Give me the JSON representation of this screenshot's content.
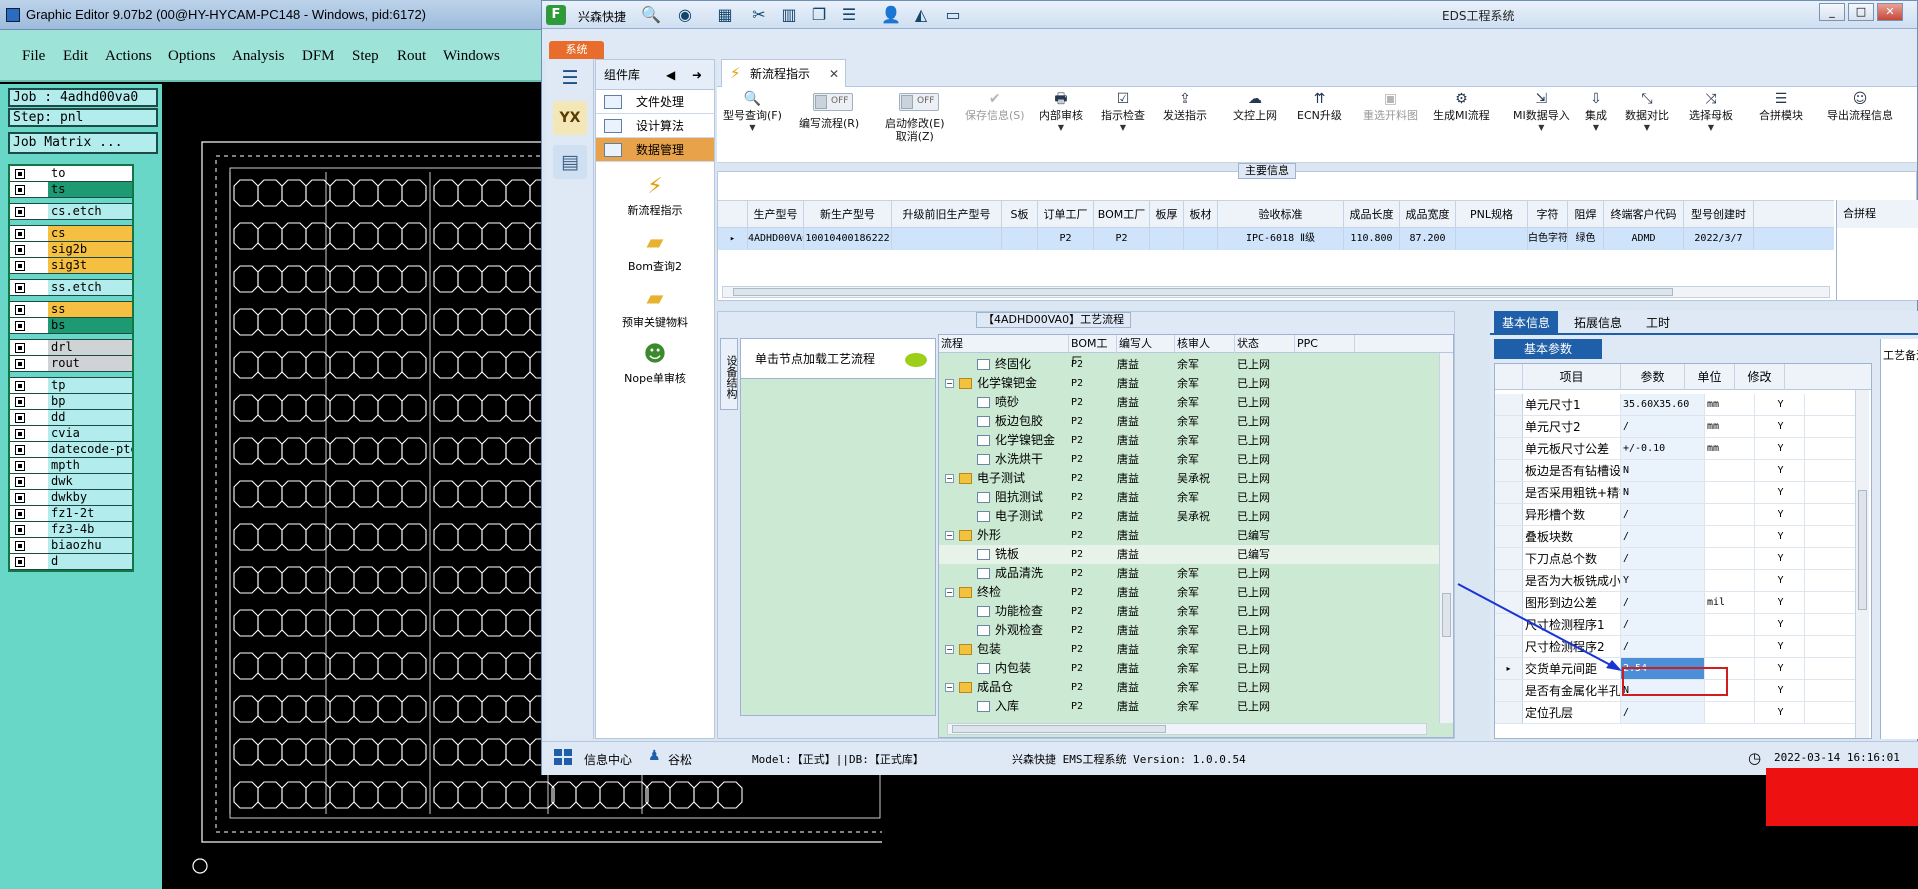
{
  "graphic_editor": {
    "title": "Graphic Editor 9.07b2 (00@HY-HYCAM-PC148 - Windows, pid:6172)",
    "menu": [
      "File",
      "Edit",
      "Actions",
      "Options",
      "Analysis",
      "DFM",
      "Step",
      "Rout",
      "Windows"
    ],
    "job": "Job : 4adhd00va0",
    "step": "Step: pnl",
    "job_matrix": "Job Matrix ...",
    "layers": [
      {
        "name": "to",
        "color": "#ffffff"
      },
      {
        "name": "ts",
        "color": "#1d9a72"
      },
      {
        "name": "cs.etch",
        "color": "#b2ecec"
      },
      {
        "name": "cs",
        "color": "#f5c042"
      },
      {
        "name": "sig2b",
        "color": "#f5c042"
      },
      {
        "name": "sig3t",
        "color": "#f5c042"
      },
      {
        "name": "ss.etch",
        "color": "#b2ecec"
      },
      {
        "name": "ss",
        "color": "#f5c042"
      },
      {
        "name": "bs",
        "color": "#1d9a72"
      },
      {
        "name": "drl",
        "color": "#cfd3d6"
      },
      {
        "name": "rout",
        "color": "#cfd3d6"
      },
      {
        "name": "tp",
        "color": "#b2ecec"
      },
      {
        "name": "bp",
        "color": "#b2ecec"
      },
      {
        "name": "dd",
        "color": "#b2ecec"
      },
      {
        "name": "cvia",
        "color": "#b2ecec"
      },
      {
        "name": "datecode-pte",
        "color": "#b2ecec"
      },
      {
        "name": "mpth",
        "color": "#b2ecec"
      },
      {
        "name": "dwk",
        "color": "#b2ecec"
      },
      {
        "name": "dwkby",
        "color": "#b2ecec"
      },
      {
        "name": "fz1-2t",
        "color": "#b2ecec"
      },
      {
        "name": "fz3-4b",
        "color": "#b2ecec"
      },
      {
        "name": "biaozhu",
        "color": "#b2ecec"
      },
      {
        "name": "d",
        "color": "#b2ecec"
      }
    ]
  },
  "eds": {
    "title": "EDS工程系统",
    "brand": "兴森快捷",
    "system_tab": "系统",
    "component_panel": {
      "title": "组件库",
      "items": [
        "文件处理",
        "设计算法",
        "数据管理"
      ],
      "big_items": [
        "新流程指示",
        "Bom查询2",
        "预审关键物料",
        "Nope单审核"
      ]
    },
    "tab": "新流程指示",
    "toolbar": [
      {
        "label": "型号查询(F)",
        "icon": "🔍",
        "dd": true,
        "disabled": false
      },
      {
        "label": "编写流程(R)",
        "icon": "",
        "dd": false,
        "disabled": false,
        "toggle": "OFF"
      },
      {
        "label": "启动修改(E)\n取消(Z)",
        "icon": "",
        "dd": false,
        "disabled": false,
        "toggle": "OFF"
      },
      {
        "label": "保存信息(S)",
        "icon": "✔",
        "dd": false,
        "disabled": true
      },
      {
        "label": "内部审核",
        "icon": "🖶",
        "dd": true,
        "disabled": false
      },
      {
        "label": "指示检查",
        "icon": "☑",
        "dd": true,
        "disabled": false
      },
      {
        "label": "发送指示",
        "icon": "⇪",
        "dd": false,
        "disabled": false
      },
      {
        "label": "文控上网",
        "icon": "☁",
        "dd": false,
        "disabled": false
      },
      {
        "label": "ECN升级",
        "icon": "⇈",
        "dd": false,
        "disabled": false
      },
      {
        "label": "重选开料图",
        "icon": "▣",
        "dd": false,
        "disabled": true
      },
      {
        "label": "生成MI流程",
        "icon": "⚙",
        "dd": false,
        "disabled": false
      },
      {
        "label": "MI数据导入",
        "icon": "⇲",
        "dd": true,
        "disabled": false
      },
      {
        "label": "集成",
        "icon": "⇩",
        "dd": true,
        "disabled": false
      },
      {
        "label": "数据对比",
        "icon": "⤡",
        "dd": true,
        "disabled": false
      },
      {
        "label": "选择母板",
        "icon": "⤨",
        "dd": true,
        "disabled": false
      },
      {
        "label": "合拼模块",
        "icon": "☰",
        "dd": false,
        "disabled": false
      },
      {
        "label": "导出流程信息",
        "icon": "☺",
        "dd": false,
        "disabled": false
      }
    ],
    "main_info": {
      "caption": "主要信息",
      "headers": [
        "生产型号",
        "新生产型号",
        "升级前旧生产型号",
        "S板",
        "订单工厂",
        "BOM工厂",
        "板厚",
        "板材",
        "验收标准",
        "成品长度",
        "成品宽度",
        "PNL规格",
        "字符",
        "阻焊",
        "终端客户代码",
        "型号创建时"
      ],
      "row": [
        "4ADHD00VA0",
        "10010400186222",
        "",
        "",
        "P2",
        "P2",
        "",
        "",
        "IPC-6018 Ⅱ级",
        "110.800",
        "87.200",
        "",
        "白色字符",
        "绿色",
        "ADMD",
        "2022/3/7"
      ],
      "right_header": "合拼程"
    },
    "process": {
      "caption": "【4ADHD00VA0】工艺流程",
      "side_tab": "设备结构",
      "node_hint": "单击节点加载工艺流程",
      "headers": [
        "流程",
        "BOM工厂",
        "编写人",
        "核审人",
        "状态",
        "PPC"
      ],
      "rows": [
        {
          "level": 1,
          "type": "page",
          "name": "终固化",
          "bom": "P2",
          "writer": "唐益",
          "reviewer": "余军",
          "status": "已上网"
        },
        {
          "level": 0,
          "type": "folder",
          "name": "化学镍钯金",
          "bom": "P2",
          "writer": "唐益",
          "reviewer": "余军",
          "status": "已上网"
        },
        {
          "level": 1,
          "type": "page",
          "name": "喷砂",
          "bom": "P2",
          "writer": "唐益",
          "reviewer": "余军",
          "status": "已上网"
        },
        {
          "level": 1,
          "type": "page",
          "name": "板边包胶",
          "bom": "P2",
          "writer": "唐益",
          "reviewer": "余军",
          "status": "已上网"
        },
        {
          "level": 1,
          "type": "page",
          "name": "化学镍钯金",
          "bom": "P2",
          "writer": "唐益",
          "reviewer": "余军",
          "status": "已上网"
        },
        {
          "level": 1,
          "type": "page",
          "name": "水洗烘干",
          "bom": "P2",
          "writer": "唐益",
          "reviewer": "余军",
          "status": "已上网"
        },
        {
          "level": 0,
          "type": "folder",
          "name": "电子测试",
          "bom": "P2",
          "writer": "唐益",
          "reviewer": "吴承祝",
          "status": "已上网"
        },
        {
          "level": 1,
          "type": "page",
          "name": "阻抗测试",
          "bom": "P2",
          "writer": "唐益",
          "reviewer": "余军",
          "status": "已上网"
        },
        {
          "level": 1,
          "type": "page",
          "name": "电子测试",
          "bom": "P2",
          "writer": "唐益",
          "reviewer": "吴承祝",
          "status": "已上网"
        },
        {
          "level": 0,
          "type": "folder",
          "name": "外形",
          "bom": "P2",
          "writer": "唐益",
          "reviewer": "",
          "status": "已编写"
        },
        {
          "level": 1,
          "type": "page",
          "name": "铣板",
          "bom": "P2",
          "writer": "唐益",
          "reviewer": "",
          "status": "已编写",
          "selected": true
        },
        {
          "level": 1,
          "type": "page",
          "name": "成品清洗",
          "bom": "P2",
          "writer": "唐益",
          "reviewer": "余军",
          "status": "已上网"
        },
        {
          "level": 0,
          "type": "folder",
          "name": "终检",
          "bom": "P2",
          "writer": "唐益",
          "reviewer": "余军",
          "status": "已上网"
        },
        {
          "level": 1,
          "type": "page",
          "name": "功能检查",
          "bom": "P2",
          "writer": "唐益",
          "reviewer": "余军",
          "status": "已上网"
        },
        {
          "level": 1,
          "type": "page",
          "name": "外观检查",
          "bom": "P2",
          "writer": "唐益",
          "reviewer": "余军",
          "status": "已上网"
        },
        {
          "level": 0,
          "type": "folder",
          "name": "包装",
          "bom": "P2",
          "writer": "唐益",
          "reviewer": "余军",
          "status": "已上网"
        },
        {
          "level": 1,
          "type": "page",
          "name": "内包装",
          "bom": "P2",
          "writer": "唐益",
          "reviewer": "余军",
          "status": "已上网"
        },
        {
          "level": 0,
          "type": "folder",
          "name": "成品仓",
          "bom": "P2",
          "writer": "唐益",
          "reviewer": "余军",
          "status": "已上网"
        },
        {
          "level": 1,
          "type": "page",
          "name": "入库",
          "bom": "P2",
          "writer": "唐益",
          "reviewer": "余军",
          "status": "已上网"
        }
      ]
    },
    "right_tabs": [
      "基本信息",
      "拓展信息",
      "工时"
    ],
    "basic_caption": "基本参数",
    "param_headers": [
      "项目",
      "参数",
      "单位",
      "修改"
    ],
    "params": [
      {
        "item": "单元尺寸1",
        "value": "35.60X35.60",
        "unit": "mm",
        "mod": "Y"
      },
      {
        "item": "单元尺寸2",
        "value": "/",
        "unit": "mm",
        "mod": "Y"
      },
      {
        "item": "单元板尺寸公差",
        "value": "+/-0.10",
        "unit": "mm",
        "mod": "Y"
      },
      {
        "item": "板边是否有钻槽设计",
        "value": "N",
        "unit": "",
        "mod": "Y"
      },
      {
        "item": "是否采用粗铣+精铣",
        "value": "N",
        "unit": "",
        "mod": "Y"
      },
      {
        "item": "异形槽个数",
        "value": "/",
        "unit": "",
        "mod": "Y"
      },
      {
        "item": "叠板块数",
        "value": "/",
        "unit": "",
        "mod": "Y"
      },
      {
        "item": "下刀点总个数",
        "value": "/",
        "unit": "",
        "mod": "Y"
      },
      {
        "item": "是否为大板铣成小板",
        "value": "Y",
        "unit": "",
        "mod": "Y"
      },
      {
        "item": "图形到边公差",
        "value": "/",
        "unit": "mil",
        "mod": "Y"
      },
      {
        "item": "尺寸检测程序1",
        "value": "/",
        "unit": "",
        "mod": "Y"
      },
      {
        "item": "尺寸检测程序2",
        "value": "/",
        "unit": "",
        "mod": "Y"
      },
      {
        "item": "交货单元间距",
        "value": "2.54",
        "unit": "",
        "mod": "Y",
        "highlight": true
      },
      {
        "item": "是否有金属化半孔",
        "value": "N",
        "unit": "",
        "mod": "Y"
      },
      {
        "item": "定位孔层",
        "value": "/",
        "unit": "",
        "mod": "Y"
      }
    ],
    "right_edge_label": "工艺备注",
    "status": {
      "info_center": "信息中心",
      "user": "谷松",
      "model": "Model:【正式】||DB:【正式库】",
      "version": "兴森快捷 EMS工程系统 Version: 1.0.0.54",
      "datetime": "2022-03-14 16:16:01"
    }
  }
}
